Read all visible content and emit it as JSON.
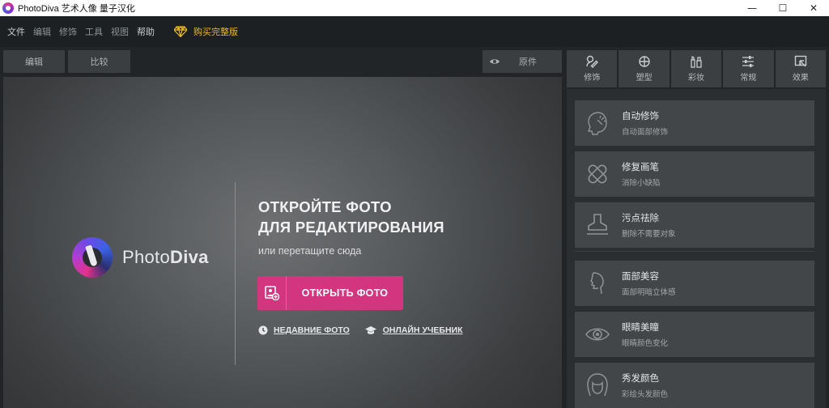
{
  "window": {
    "title": "PhotoDiva 艺术人像 量子汉化",
    "controls": [
      "—",
      "☐",
      "✕"
    ]
  },
  "menu": {
    "items": [
      "文件",
      "编辑",
      "修饰",
      "工具",
      "视图",
      "帮助"
    ],
    "buy_label": "购买完整版"
  },
  "toolbar": {
    "edit_label": "编辑",
    "compare_label": "比较",
    "original_label": "原件"
  },
  "canvas": {
    "logo_name_regular": "Photo",
    "logo_name_bold": "Diva",
    "headline_line1": "ОТКРОЙТЕ ФОТО",
    "headline_line2": "ДЛЯ РЕДАКТИРОВАНИЯ",
    "subtitle": "или перетащите сюда",
    "open_button_label": "ОТКРЫТЬ ФОТО",
    "recent_label": "НЕДАВНИЕ ФОТО",
    "tutorial_label": "ОНЛАЙН УЧЕБНИК"
  },
  "panel": {
    "tabs": [
      {
        "label": "修饰",
        "icon": "retouch-brush-icon"
      },
      {
        "label": "塑型",
        "icon": "shape-icon"
      },
      {
        "label": "彩妆",
        "icon": "makeup-icon"
      },
      {
        "label": "常规",
        "icon": "sliders-icon"
      },
      {
        "label": "效果",
        "icon": "effects-icon"
      }
    ],
    "cards": [
      {
        "title": "自动修饰",
        "subtitle": "自动面部修饰",
        "icon": "auto-retouch-icon"
      },
      {
        "title": "修复画笔",
        "subtitle": "消除小缺陷",
        "icon": "healing-bandage-icon"
      },
      {
        "title": "污点祛除",
        "subtitle": "删除不需要对象",
        "icon": "stamp-icon"
      },
      {
        "title": "面部美容",
        "subtitle": "面部明暗立体感",
        "icon": "face-profile-icon"
      },
      {
        "title": "眼睛美瞳",
        "subtitle": "眼睛颜色变化",
        "icon": "eye-icon"
      },
      {
        "title": "秀发颜色",
        "subtitle": "彩绘头发颜色",
        "icon": "hair-icon"
      }
    ]
  },
  "colors": {
    "accent": "#d4357f",
    "buy": "#e8b824",
    "background": "#222527"
  }
}
